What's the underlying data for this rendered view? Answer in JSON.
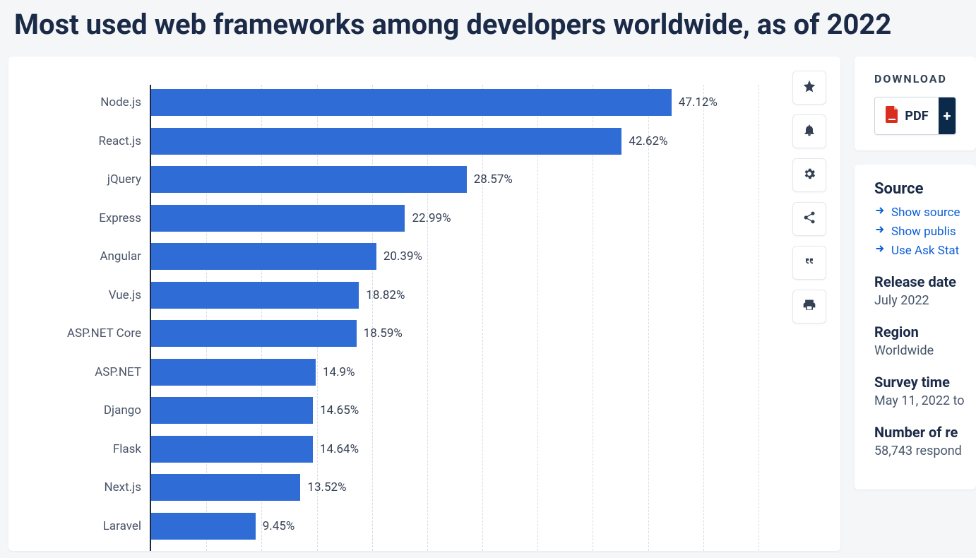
{
  "title": "Most used web frameworks among developers worldwide, as of 2022",
  "chart_data": {
    "type": "bar",
    "orientation": "horizontal",
    "categories": [
      "Node.js",
      "React.js",
      "jQuery",
      "Express",
      "Angular",
      "Vue.js",
      "ASP.NET Core",
      "ASP.NET",
      "Django",
      "Flask",
      "Next.js",
      "Laravel"
    ],
    "values": [
      47.12,
      42.62,
      28.57,
      22.99,
      20.39,
      18.82,
      18.59,
      14.9,
      14.65,
      14.64,
      13.52,
      9.45
    ],
    "value_labels": [
      "47.12%",
      "42.62%",
      "28.57%",
      "22.99%",
      "20.39%",
      "18.82%",
      "18.59%",
      "14.9%",
      "14.65%",
      "14.64%",
      "13.52%",
      "9.45%"
    ],
    "xlim": [
      0,
      55
    ],
    "xgrid_step": 5,
    "bar_color": "#2f6cd6",
    "title": "",
    "xlabel": "",
    "ylabel": ""
  },
  "toolbar": {
    "favorite": "Favorite",
    "notify": "Notifications",
    "settings": "Settings",
    "share": "Share",
    "cite": "Cite",
    "print": "Print"
  },
  "download": {
    "heading": "DOWNLOAD",
    "pdf_label": "PDF",
    "pdf_plus": "+"
  },
  "meta": {
    "source_heading": "Source",
    "links": {
      "show_sources": "Show source",
      "show_publisher": "Show publis",
      "ask_statista": "Use Ask Stat"
    },
    "release_date_label": "Release date",
    "release_date_value": "July 2022",
    "region_label": "Region",
    "region_value": "Worldwide",
    "survey_time_label": "Survey time",
    "survey_time_value": "May 11, 2022 to",
    "respondents_label": "Number of re",
    "respondents_value": "58,743 respond"
  }
}
